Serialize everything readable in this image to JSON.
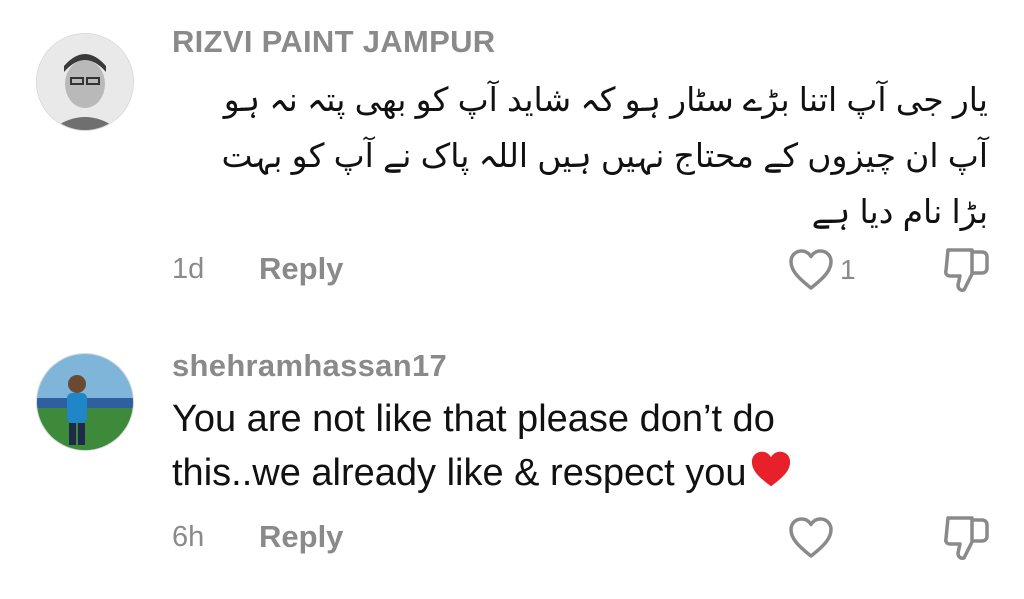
{
  "comments": [
    {
      "username": "RIZVI PAINT JAMPUR",
      "text_lines": [
        "یار جی آپ اتنا بڑے سٹار ہو کہ شاید آپ کو بھی پتہ نہ ہو",
        "آپ ان چیزوں کے محتاج نہیں ہیں اللہ پاک نے آپ کو بہت",
        "بڑا نام دیا ہے"
      ],
      "age": "1d",
      "reply_label": "Reply",
      "like_count": "1"
    },
    {
      "username": "shehramhassan17",
      "text_lines": [
        "You are not like that please don’t do",
        "this..we already like & respect you"
      ],
      "age": "6h",
      "reply_label": "Reply",
      "like_count": ""
    }
  ],
  "icons": {
    "like": "heart-outline-icon",
    "dislike": "thumbs-down-icon",
    "emoji": "red-heart-emoji"
  },
  "colors": {
    "muted": "#8a8a8a",
    "text": "#111111",
    "emoji_heart": "#e8202a"
  }
}
